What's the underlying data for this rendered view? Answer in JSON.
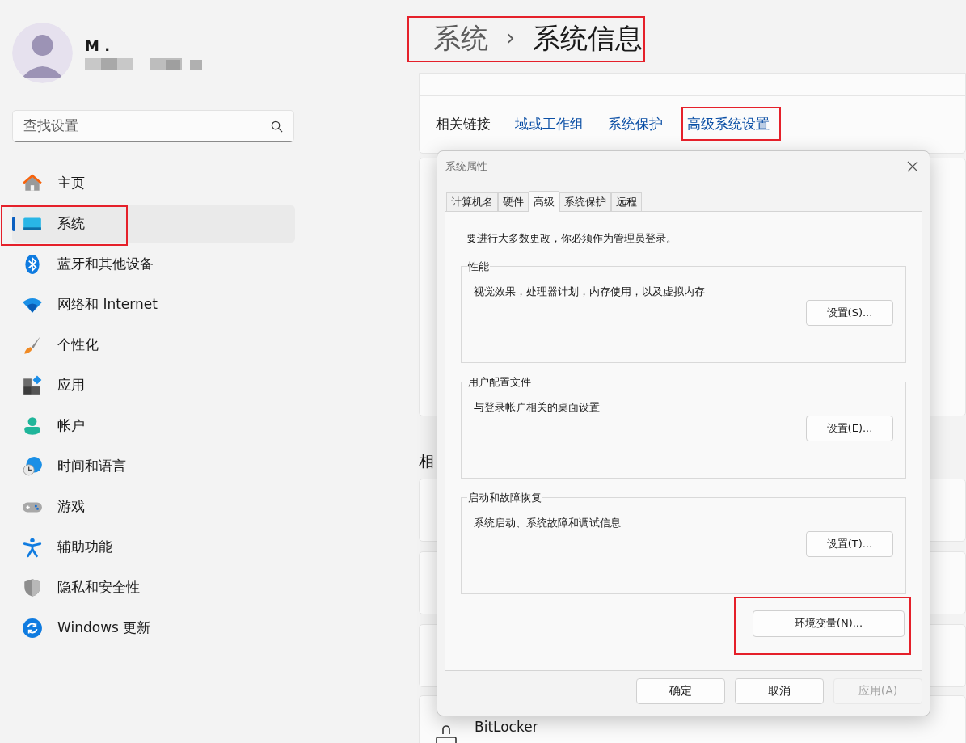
{
  "profile": {
    "name": "M ."
  },
  "search": {
    "placeholder": "查找设置"
  },
  "nav": [
    {
      "label": "主页",
      "kind": "home",
      "selected": false
    },
    {
      "label": "系统",
      "kind": "system",
      "selected": true
    },
    {
      "label": "蓝牙和其他设备",
      "kind": "bluetooth",
      "selected": false
    },
    {
      "label": "网络和 Internet",
      "kind": "wifi",
      "selected": false
    },
    {
      "label": "个性化",
      "kind": "brush",
      "selected": false
    },
    {
      "label": "应用",
      "kind": "apps",
      "selected": false
    },
    {
      "label": "帐户",
      "kind": "person",
      "selected": false
    },
    {
      "label": "时间和语言",
      "kind": "globe",
      "selected": false
    },
    {
      "label": "游戏",
      "kind": "gamepad",
      "selected": false
    },
    {
      "label": "辅助功能",
      "kind": "accessibility",
      "selected": false
    },
    {
      "label": "隐私和安全性",
      "kind": "shield",
      "selected": false
    },
    {
      "label": "Windows 更新",
      "kind": "update",
      "selected": false
    }
  ],
  "breadcrumb": {
    "parent": "系统",
    "separator": "›",
    "current": "系统信息"
  },
  "related_links": {
    "label": "相关链接",
    "links": [
      "域或工作组",
      "系统保护",
      "高级系统设置"
    ]
  },
  "related_heading": "相",
  "bitlocker": {
    "title": "BitLocker"
  },
  "dialog": {
    "title": "系统属性",
    "tabs": [
      {
        "label": "计算机名",
        "selected": false
      },
      {
        "label": "硬件",
        "selected": false
      },
      {
        "label": "高级",
        "selected": true
      },
      {
        "label": "系统保护",
        "selected": false
      },
      {
        "label": "远程",
        "selected": false
      }
    ],
    "admin_note": "要进行大多数更改，你必须作为管理员登录。",
    "groups": [
      {
        "legend": "性能",
        "description": "视觉效果，处理器计划，内存使用，以及虚拟内存",
        "button": "设置(S)..."
      },
      {
        "legend": "用户配置文件",
        "description": "与登录帐户相关的桌面设置",
        "button": "设置(E)..."
      },
      {
        "legend": "启动和故障恢复",
        "description": "系统启动、系统故障和调试信息",
        "button": "设置(T)..."
      }
    ],
    "env_button": "环境变量(N)...",
    "footer": [
      {
        "label": "确定",
        "disabled": false
      },
      {
        "label": "取消",
        "disabled": false
      },
      {
        "label": "应用(A)",
        "disabled": true
      }
    ]
  }
}
